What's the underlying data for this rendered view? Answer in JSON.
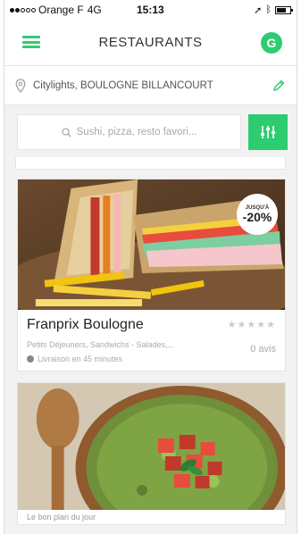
{
  "status_bar": {
    "carrier": "Orange F",
    "network": "4G",
    "time": "15:13"
  },
  "header": {
    "title": "RESTAURANTS",
    "avatar_letter": "G",
    "menu_icon": "hamburger-icon"
  },
  "address": {
    "text": "Citylights, BOULOGNE BILLANCOURT",
    "location_icon": "pin-icon",
    "edit_icon": "pencil-icon"
  },
  "search": {
    "placeholder": "Sushi, pizza, resto favori...",
    "filter_icon": "sliders-icon"
  },
  "restaurants": [
    {
      "name": "Franprix Boulogne",
      "promo_top": "JUSQU'À",
      "promo_value": "-20%",
      "categories": "Petits Déjeuners, Sandwichs - Salades,...",
      "reviews": "0 avis",
      "delivery": "Livraison en 45 minutes",
      "rating": 0
    },
    {
      "name": "",
      "footer_fragment": "Le bon plan du jour"
    }
  ],
  "colors": {
    "accent": "#2ecc71"
  }
}
